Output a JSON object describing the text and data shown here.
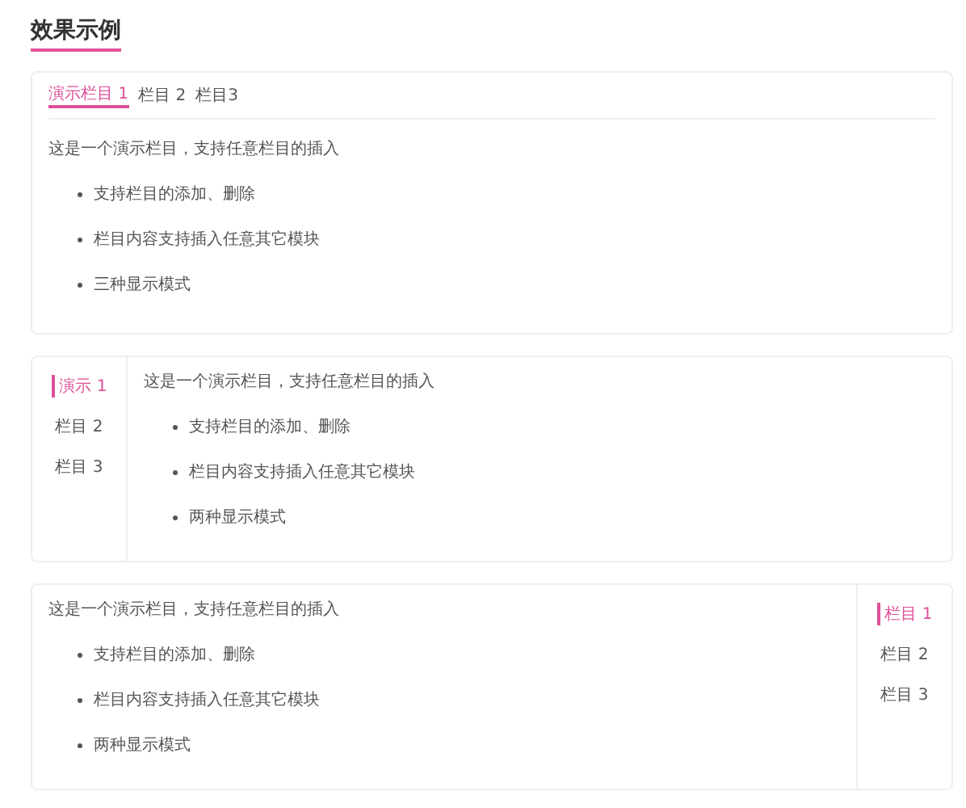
{
  "title": "效果示例",
  "panels": [
    {
      "kind": "top",
      "tabs": [
        {
          "label": "演示栏目 1",
          "selected": true
        },
        {
          "label": "栏目 2",
          "selected": false
        },
        {
          "label": "栏目3",
          "selected": false
        }
      ],
      "paragraph": "这是一个演示栏目，支持任意栏目的插入",
      "bullets": [
        "支持栏目的添加、删除",
        "栏目内容支持插入任意其它模块",
        "三种显示模式"
      ]
    },
    {
      "kind": "left",
      "tabs": [
        {
          "label": "演示 1",
          "selected": true
        },
        {
          "label": "栏目 2",
          "selected": false
        },
        {
          "label": "栏目 3",
          "selected": false
        }
      ],
      "paragraph": "这是一个演示栏目，支持任意栏目的插入",
      "bullets": [
        "支持栏目的添加、删除",
        "栏目内容支持插入任意其它模块",
        "两种显示模式"
      ]
    },
    {
      "kind": "right",
      "tabs": [
        {
          "label": "栏目 1",
          "selected": true
        },
        {
          "label": "栏目 2",
          "selected": false
        },
        {
          "label": "栏目 3",
          "selected": false
        }
      ],
      "paragraph": "这是一个演示栏目，支持任意栏目的插入",
      "bullets": [
        "支持栏目的添加、删除",
        "栏目内容支持插入任意其它模块",
        "两种显示模式"
      ]
    }
  ]
}
